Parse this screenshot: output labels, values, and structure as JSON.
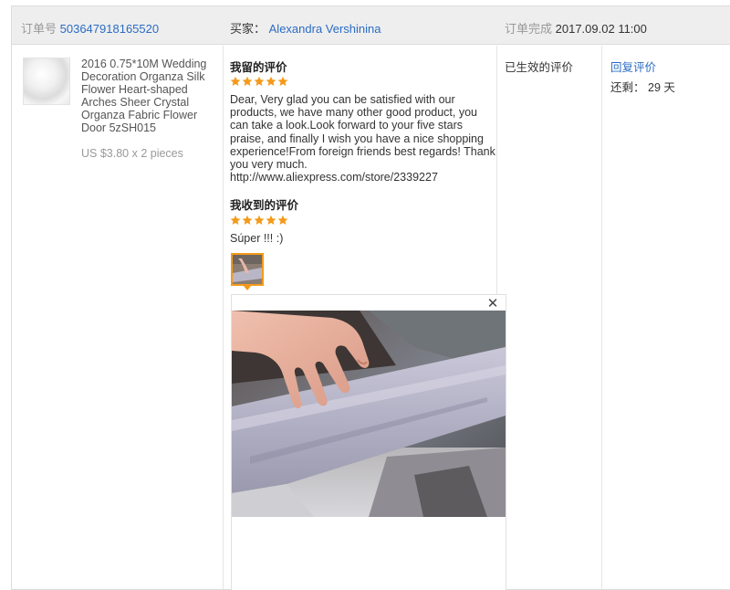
{
  "order": {
    "number_label": "订单号",
    "number": "503647918165520",
    "buyer_label": "买家：",
    "buyer_name": "Alexandra Vershinina",
    "completed_label": "订单完成",
    "completed_time": "2017.09.02 11:00"
  },
  "product": {
    "title": "2016 0.75*10M Wedding Decoration Organza Silk Flower Heart-shaped Arches Sheer Crystal Organza Fabric Flower Door 5zSH015",
    "price": "US $3.80 x 2 pieces"
  },
  "my_review": {
    "title": "我留的评价",
    "rating": 5,
    "text": "Dear, Very glad you can be satisfied with our products, we have many other good product, you can take a look.Look forward to your five stars praise, and finally I wish you have a nice shopping experience!From foreign friends best regards! Thank you very much.",
    "link": "http://www.aliexpress.com/store/2339227"
  },
  "received_review": {
    "title": "我收到的评价",
    "rating": 5,
    "text": "Súper !!! :)"
  },
  "status": {
    "label": "已生效的评价"
  },
  "actions": {
    "reply_label": "回复评价",
    "remaining_label": "还剩：",
    "remaining_value": "29 天"
  },
  "icons": {
    "star": "star-icon",
    "close": "close-icon"
  },
  "colors": {
    "link": "#2b6cc4",
    "star": "#f49a1a",
    "header_bg": "#eeeeee"
  }
}
